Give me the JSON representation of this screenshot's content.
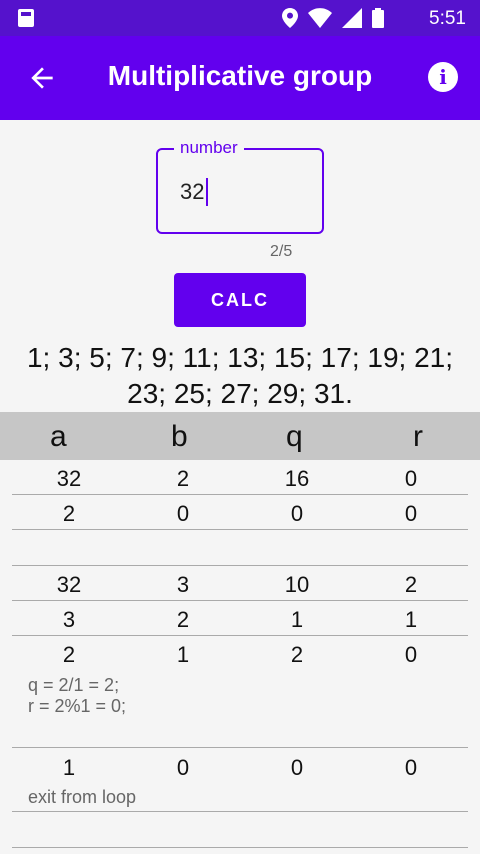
{
  "status": {
    "time": "5:51"
  },
  "appbar": {
    "title": "Multiplicative group"
  },
  "input": {
    "label": "number",
    "value": "32",
    "counter": "2/5"
  },
  "calc_label": "CALC",
  "result": {
    "line1": "1; 3; 5; 7; 9; 11; 13; 15; 17; 19; 21;",
    "line2": "23; 25; 27; 29; 31."
  },
  "table": {
    "headers": [
      "a",
      "b",
      "q",
      "r"
    ],
    "rows": [
      {
        "cells": [
          "32",
          "2",
          "16",
          "0"
        ]
      },
      {
        "cells": [
          "2",
          "0",
          "0",
          "0"
        ]
      },
      {
        "cells": [
          "",
          "",
          "",
          ""
        ]
      },
      {
        "cells": [
          "32",
          "3",
          "10",
          "2"
        ]
      },
      {
        "cells": [
          "3",
          "2",
          "1",
          "1"
        ]
      },
      {
        "cells": [
          "2",
          "1",
          "2",
          "0"
        ],
        "note1": "q = 2/1 = 2;",
        "note2": "r = 2%1 = 0;"
      },
      {
        "cells": [
          "1",
          "0",
          "0",
          "0"
        ],
        "note1": "exit from loop"
      }
    ]
  }
}
